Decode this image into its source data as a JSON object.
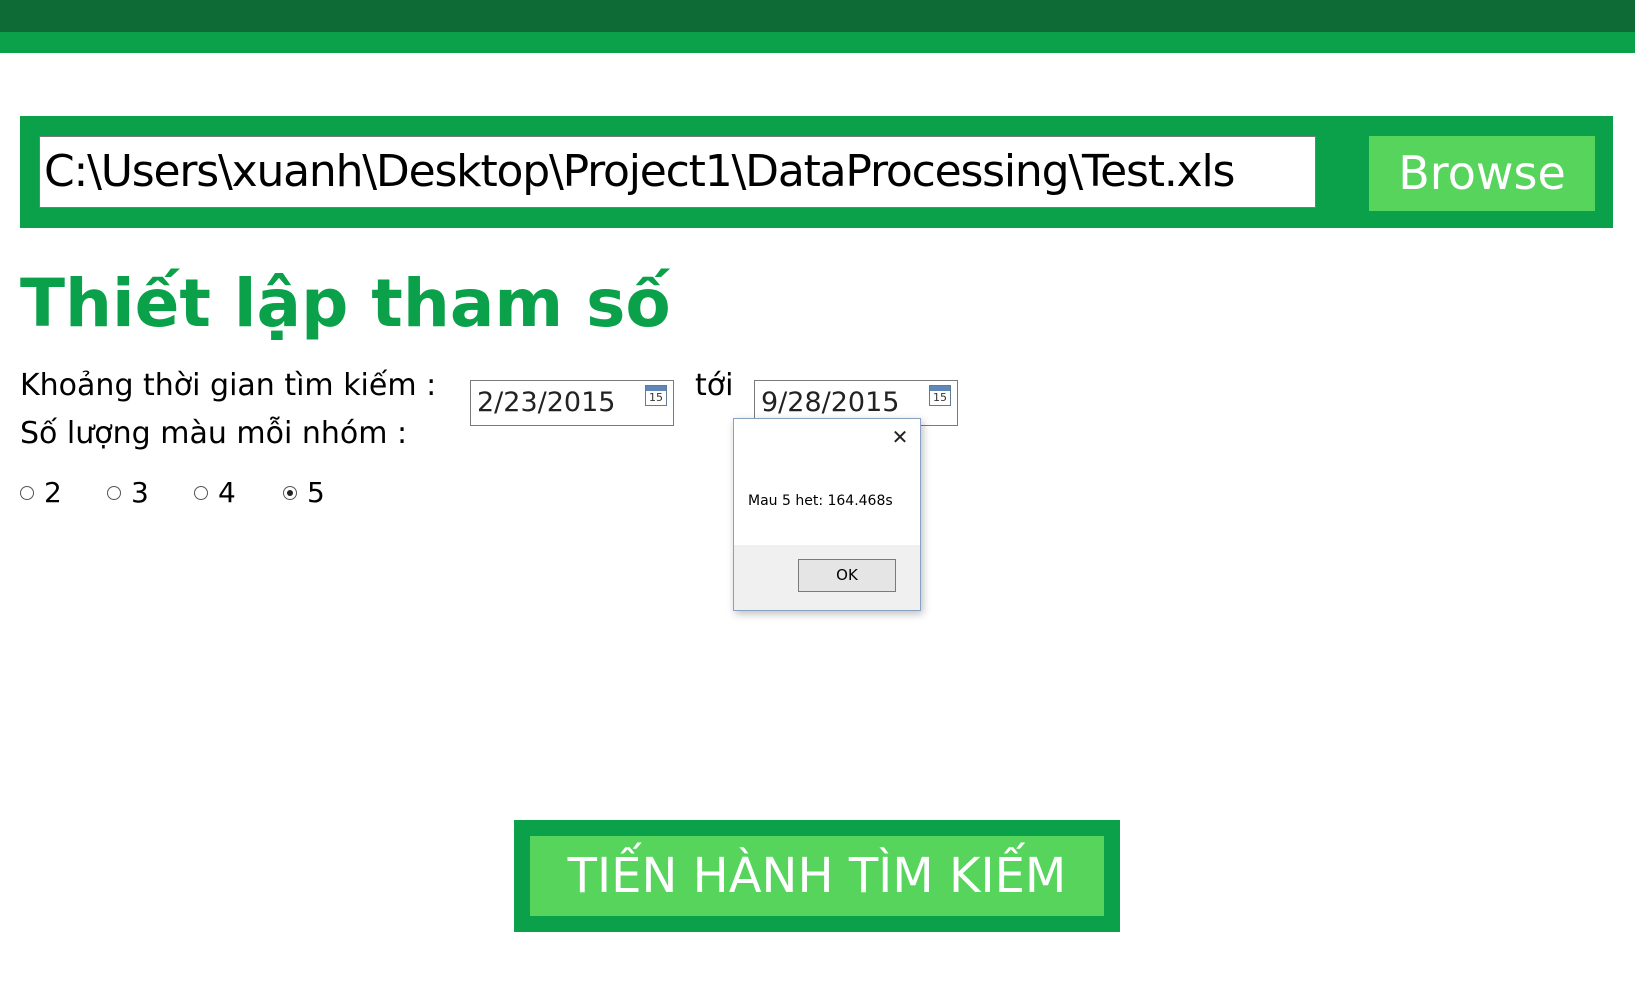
{
  "file_bar": {
    "path_value": "C:\\Users\\xuanh\\Desktop\\Project1\\DataProcessing\\Test.xls",
    "browse_label": "Browse"
  },
  "settings": {
    "title": "Thiết lập tham số",
    "time_range_label": "Khoảng thời gian tìm kiếm :",
    "from_date": "2/23/2015",
    "to_label": "tới",
    "to_date": "9/28/2015",
    "calendar_day": "15",
    "colors_per_group_label": "Số lượng màu mỗi nhóm :",
    "radio_options": [
      "2",
      "3",
      "4",
      "5"
    ],
    "selected_option": "5"
  },
  "dialog": {
    "close_glyph": "✕",
    "message": "Mau 5 het: 164.468s",
    "ok_label": "OK"
  },
  "search_button_label": "TIẾN HÀNH TÌM KIẾM",
  "colors": {
    "dark_green": "#0f6b36",
    "green": "#0aa14a",
    "light_green": "#56d45c"
  }
}
